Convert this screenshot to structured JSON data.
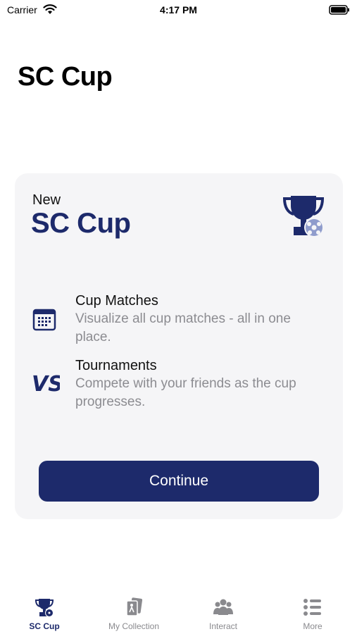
{
  "status_bar": {
    "carrier": "Carrier",
    "time": "4:17 PM"
  },
  "page": {
    "title": "SC Cup"
  },
  "card": {
    "eyebrow": "New",
    "title": "SC Cup",
    "icon": "trophy-icon",
    "features": [
      {
        "icon": "calendar-icon",
        "title": "Cup Matches",
        "description": "Visualize all cup matches - all in one place."
      },
      {
        "icon": "vs-icon",
        "title": "Tournaments",
        "description": "Compete with your friends as the cup progresses."
      }
    ],
    "button_label": "Continue"
  },
  "tab_bar": {
    "items": [
      {
        "label": "SC Cup",
        "icon": "trophy-icon",
        "active": true
      },
      {
        "label": "My Collection",
        "icon": "cards-icon",
        "active": false
      },
      {
        "label": "Interact",
        "icon": "people-icon",
        "active": false
      },
      {
        "label": "More",
        "icon": "list-icon",
        "active": false
      }
    ]
  },
  "colors": {
    "accent": "#1d2a6b",
    "secondary_text": "#8c8c91",
    "card_bg": "#f5f5f7"
  }
}
